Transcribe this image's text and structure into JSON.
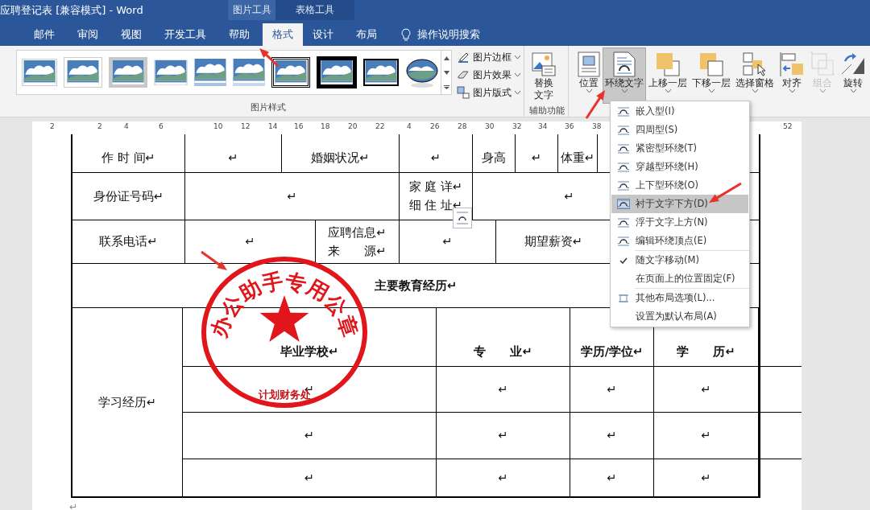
{
  "window": {
    "title": "应聘登记表 [兼容模式]  -  Word"
  },
  "context_groups": [
    {
      "label": "图片工具",
      "selected": true
    },
    {
      "label": "表格工具",
      "selected": false
    }
  ],
  "tabs": [
    {
      "label": "邮件",
      "selected": false
    },
    {
      "label": "审阅",
      "selected": false
    },
    {
      "label": "视图",
      "selected": false
    },
    {
      "label": "开发工具",
      "selected": false
    },
    {
      "label": "帮助",
      "selected": false
    },
    {
      "label": "格式",
      "selected": true
    },
    {
      "label": "设计",
      "selected": false
    },
    {
      "label": "布局",
      "selected": false
    }
  ],
  "tell_me": {
    "label": "操作说明搜索"
  },
  "ribbon": {
    "picture_styles": {
      "label": "图片样式",
      "items": [
        {
          "kind": "shadow"
        },
        {
          "kind": "frame"
        },
        {
          "kind": "matte"
        },
        {
          "kind": "soft"
        },
        {
          "kind": "reflect"
        },
        {
          "kind": "fade"
        },
        {
          "kind": "double"
        },
        {
          "kind": "thick"
        },
        {
          "kind": "black"
        },
        {
          "kind": "oval"
        }
      ]
    },
    "style_commands": [
      {
        "label": "图片边框"
      },
      {
        "label": "图片效果"
      },
      {
        "label": "图片版式"
      }
    ],
    "accessibility": {
      "label": "辅助功能",
      "button": [
        "替换",
        "文字"
      ]
    },
    "arrange": [
      {
        "label": "位置",
        "pressed": false,
        "disabled": false
      },
      {
        "label": "环绕文字",
        "pressed": true,
        "disabled": false
      },
      {
        "label": "上移一层",
        "pressed": false,
        "disabled": false
      },
      {
        "label": "下移一层",
        "pressed": false,
        "disabled": false
      },
      {
        "label": "选择窗格",
        "pressed": false,
        "disabled": false
      },
      {
        "label": "对齐",
        "pressed": false,
        "disabled": false
      },
      {
        "label": "组合",
        "pressed": false,
        "disabled": true
      },
      {
        "label": "旋转",
        "pressed": false,
        "disabled": false
      }
    ]
  },
  "ruler": {
    "labels": [
      "2",
      "2",
      "4",
      "6",
      "10",
      "12",
      "14",
      "16",
      "18",
      "20",
      "22",
      "4",
      "26",
      "28",
      "30",
      "32",
      "34",
      "36",
      "38",
      "52"
    ]
  },
  "registration_form": {
    "lines": [
      {
        "fields": [
          {
            "text": [
              "作 时 间↵"
            ],
            "bold": false
          },
          {
            "text": [
              "↵"
            ],
            "bold": false
          },
          {
            "text": [
              "婚姻状况↵"
            ],
            "bold": false
          },
          {
            "text": [
              "↵"
            ],
            "bold": false
          },
          {
            "text": [
              "身高"
            ],
            "bold": false
          },
          {
            "text": [
              "↵"
            ],
            "bold": false
          },
          {
            "text": [
              "体重↵"
            ],
            "bold": false
          }
        ]
      },
      {
        "fields": [
          {
            "text": [
              "身份证号码↵"
            ],
            "bold": false
          },
          {
            "text": [
              "↵"
            ],
            "bold": false
          },
          {
            "text": [
              "家 庭 详↵",
              "细 住 址↵"
            ],
            "bold": false
          },
          {
            "text": [
              "↵"
            ],
            "bold": false
          }
        ]
      },
      {
        "fields": [
          {
            "text": [
              "联系电话↵"
            ],
            "bold": false
          },
          {
            "text": [
              "↵"
            ],
            "bold": false
          },
          {
            "text": [
              "应聘信息↵",
              "来　　源↵"
            ],
            "bold": false
          },
          {
            "text": [
              "↵"
            ],
            "bold": false
          },
          {
            "text": [
              "期望薪资↵"
            ],
            "bold": false
          }
        ]
      },
      {
        "fields": [
          {
            "text": [
              "主要教育经历↵"
            ],
            "bold": true
          }
        ]
      }
    ],
    "education": {
      "label": {
        "text": [
          "学习经历↵"
        ],
        "bold": false
      },
      "lines": [
        {
          "fields": [
            {
              "text": [
                "毕业学校↵"
              ],
              "bold": true
            },
            {
              "text": [
                "专　　业↵"
              ],
              "bold": true
            },
            {
              "text": [
                "学历/学位↵"
              ],
              "bold": true
            },
            {
              "text": [
                "学　　历↵"
              ],
              "bold": true
            }
          ]
        },
        {
          "fields": [
            {
              "text": [
                "↵"
              ],
              "bold": false
            },
            {
              "text": [
                "↵"
              ],
              "bold": false
            },
            {
              "text": [
                "↵"
              ],
              "bold": false
            },
            {
              "text": [
                "↵"
              ],
              "bold": false
            }
          ]
        },
        {
          "fields": [
            {
              "text": [
                "↵"
              ],
              "bold": false
            },
            {
              "text": [
                "↵"
              ],
              "bold": false
            },
            {
              "text": [
                "↵"
              ],
              "bold": false
            },
            {
              "text": [
                "↵"
              ],
              "bold": false
            }
          ]
        },
        {
          "fields": [
            {
              "text": [
                "↵"
              ],
              "bold": false
            },
            {
              "text": [
                "↵"
              ],
              "bold": false
            },
            {
              "text": [
                "↵"
              ],
              "bold": false
            },
            {
              "text": [
                "↵"
              ],
              "bold": false
            }
          ]
        }
      ]
    },
    "after": "↵"
  },
  "stamp": {
    "ring_text": "办公助手专用公章",
    "bottom_text": "计划财务处"
  },
  "wrap_menu": {
    "groups": [
      [
        {
          "label": "嵌入型(I)",
          "highlighted": false,
          "checked": false
        },
        {
          "label": "四周型(S)",
          "highlighted": false,
          "checked": false
        },
        {
          "label": "紧密型环绕(T)",
          "highlighted": false,
          "checked": false
        },
        {
          "label": "穿越型环绕(H)",
          "highlighted": false,
          "checked": false
        },
        {
          "label": "上下型环绕(O)",
          "highlighted": false,
          "checked": false
        },
        {
          "label": "衬于文字下方(D)",
          "highlighted": true,
          "checked": false
        },
        {
          "label": "浮于文字上方(N)",
          "highlighted": false,
          "checked": false
        },
        {
          "label": "编辑环绕顶点(E)",
          "highlighted": false,
          "checked": false
        }
      ],
      [
        {
          "label": "随文字移动(M)",
          "highlighted": false,
          "checked": true
        },
        {
          "label": "在页面上的位置固定(F)",
          "highlighted": false,
          "checked": false
        }
      ],
      [
        {
          "label": "其他布局选项(L)...",
          "highlighted": false,
          "checked": false
        },
        {
          "label": "设置为默认布局(A)",
          "highlighted": false,
          "checked": false
        }
      ]
    ]
  }
}
